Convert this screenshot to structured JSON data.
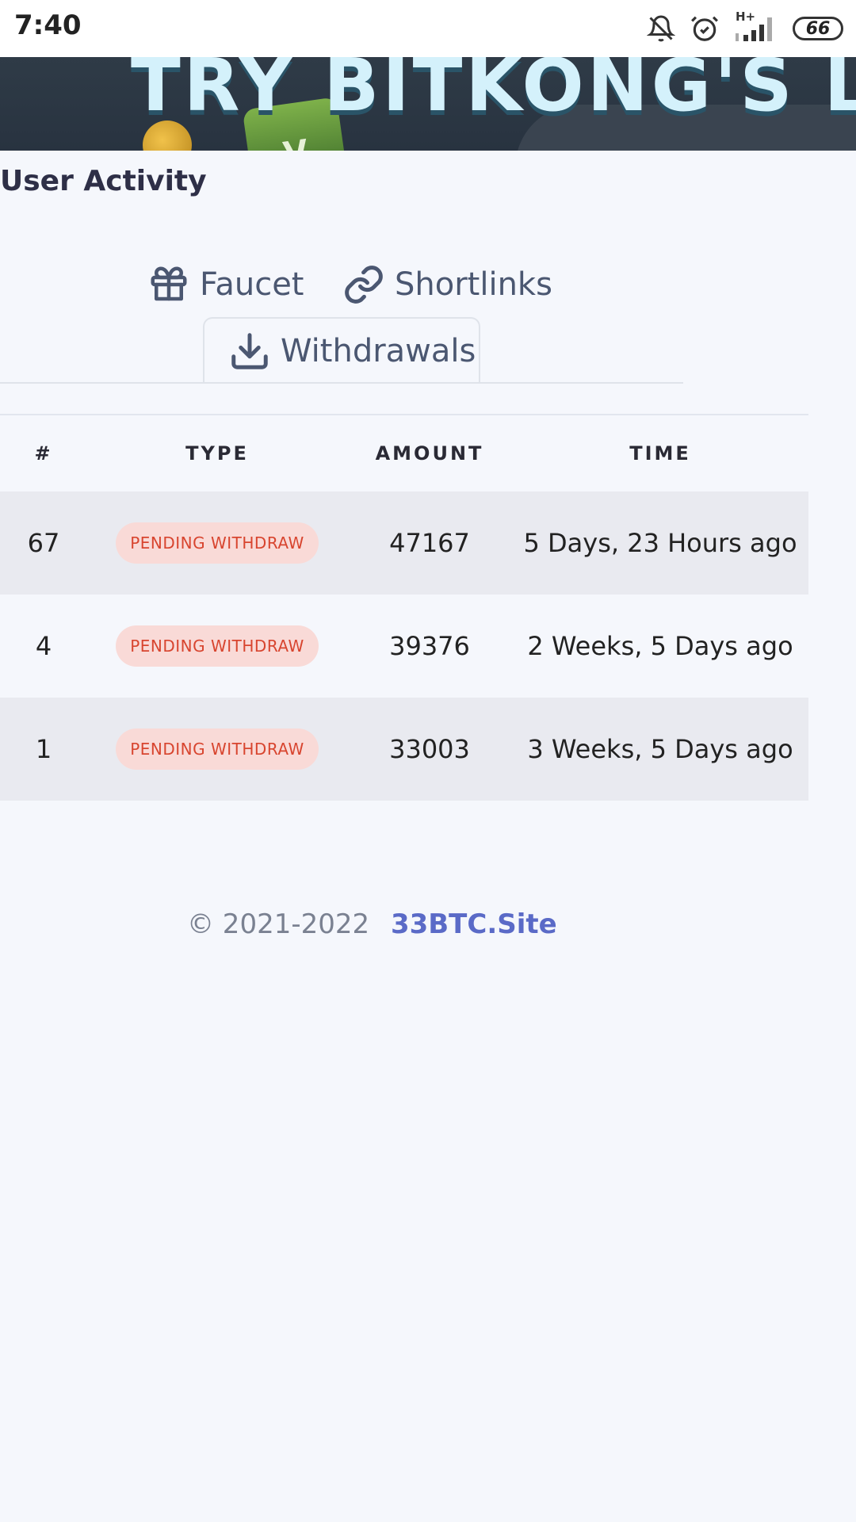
{
  "status_bar": {
    "time": "7:40",
    "battery": "66",
    "network": "H+",
    "icons": [
      "bell-off-icon",
      "alarm-icon",
      "signal-icon",
      "battery-icon"
    ]
  },
  "banner": {
    "text": "TRY BITKONG'S LAT"
  },
  "section": {
    "title": "User Activity"
  },
  "tabs": [
    {
      "label": "Faucet",
      "icon": "gift-icon",
      "active": false
    },
    {
      "label": "Shortlinks",
      "icon": "link-icon",
      "active": false
    },
    {
      "label": "Withdrawals",
      "icon": "download-icon",
      "active": true
    }
  ],
  "table": {
    "headers": [
      "#",
      "TYPE",
      "AMOUNT",
      "TIME"
    ],
    "rows": [
      {
        "num": "67",
        "type": "PENDING WITHDRAW",
        "amount": "47167",
        "time": "5 Days, 23 Hours ago"
      },
      {
        "num": "4",
        "type": "PENDING WITHDRAW",
        "amount": "39376",
        "time": "2 Weeks, 5 Days ago"
      },
      {
        "num": "1",
        "type": "PENDING WITHDRAW",
        "amount": "33003",
        "time": "3 Weeks, 5 Days ago"
      }
    ]
  },
  "footer": {
    "copyright": "© 2021-2022",
    "brand": "33BTC.Site"
  },
  "colors": {
    "badge_bg": "#f9dad7",
    "badge_text": "#d8452f",
    "brand_link": "#5a6ac7",
    "page_bg": "#f5f7fc"
  }
}
